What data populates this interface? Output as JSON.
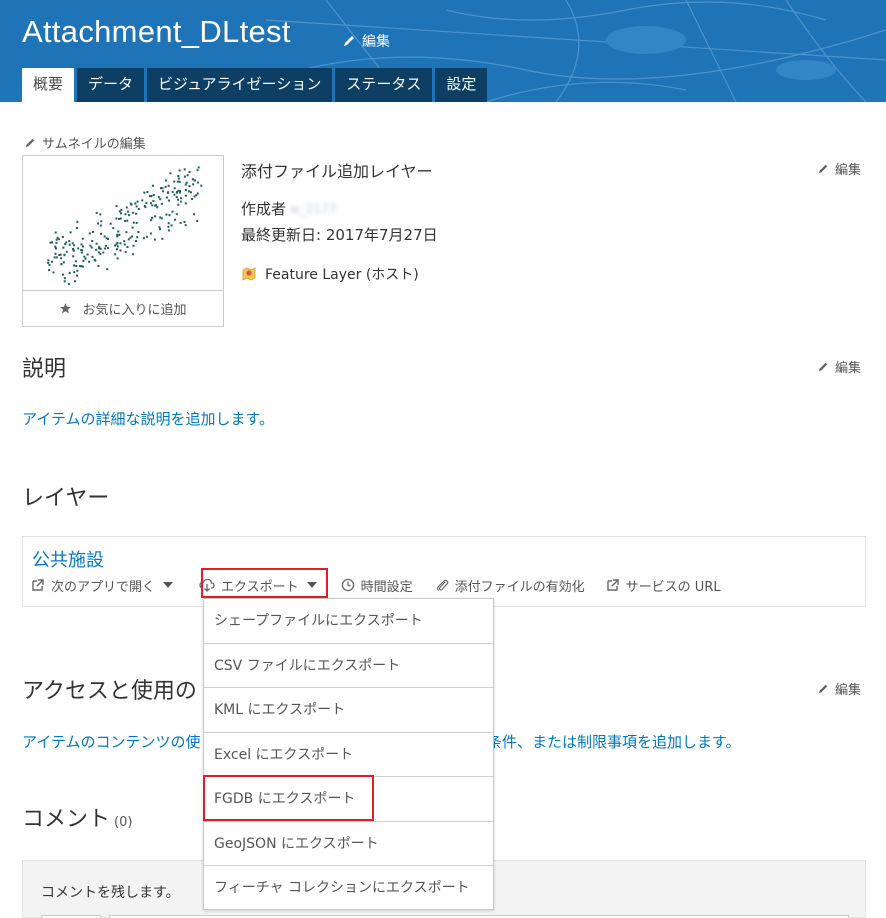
{
  "header": {
    "title": "Attachment_DLtest",
    "edit_label": "編集",
    "tabs": [
      {
        "label": "概要",
        "active": true
      },
      {
        "label": "データ",
        "active": false
      },
      {
        "label": "ビジュアライゼーション",
        "active": false
      },
      {
        "label": "ステータス",
        "active": false
      },
      {
        "label": "設定",
        "active": false
      }
    ],
    "bg_color": "#1f74b7",
    "tab_color": "#0c3f63"
  },
  "thumbnail": {
    "edit_label": "サムネイルの編集",
    "favorite_label": "お気に入りに追加"
  },
  "item": {
    "name": "添付ファイル追加レイヤー",
    "owner_label": "作成者",
    "owner_value": "w_2177",
    "modified": "最終更新日: 2017年7月27日",
    "type": "Feature Layer (ホスト)",
    "edit_label": "編集"
  },
  "description": {
    "heading": "説明",
    "link": "アイテムの詳細な説明を追加します。",
    "edit_label": "編集"
  },
  "layers": {
    "heading": "レイヤー",
    "layer_name": "公共施設",
    "actions": {
      "open_in": "次のアプリで開く",
      "export": "エクスポート",
      "time": "時間設定",
      "attachments": "添付ファイルの有効化",
      "service_url": "サービスの URL"
    }
  },
  "export_menu": {
    "items": [
      "シェープファイルにエクスポート",
      "CSV ファイルにエクスポート",
      "KML にエクスポート",
      "Excel にエクスポート",
      "FGDB にエクスポート",
      "GeoJSON にエクスポート",
      "フィーチャ コレクションにエクスポート"
    ],
    "highlighted_index": 4
  },
  "access": {
    "heading": "アクセスと使用の",
    "link_start": "アイテムのコンテンツの使",
    "link_end": "の条件、または制限事項を追加します。",
    "edit_label": "編集"
  },
  "comments": {
    "heading": "コメント",
    "count": "(0)",
    "prompt": "コメントを残します。"
  },
  "colors": {
    "link": "#0079c1",
    "highlight": "#e01e24",
    "dot": "#1d5e5b"
  }
}
